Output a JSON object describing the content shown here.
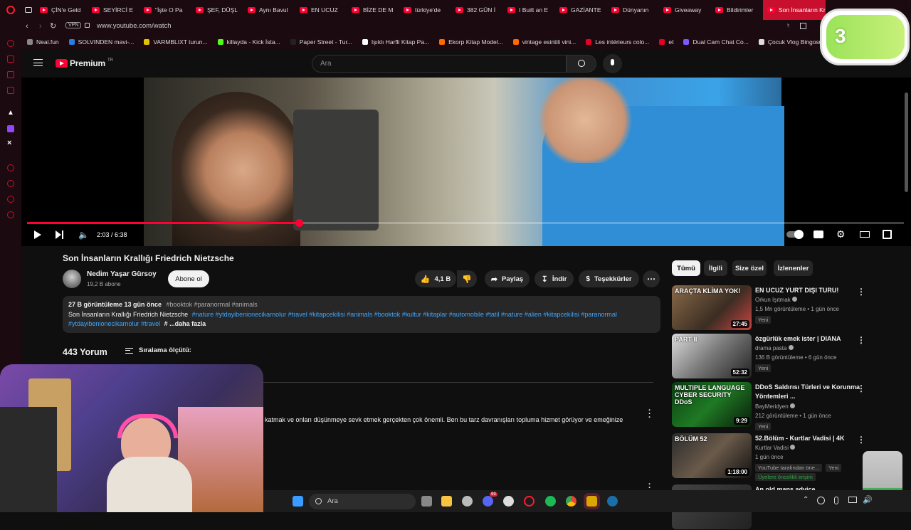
{
  "browser": {
    "tabs": [
      {
        "label": "ÇİN'e Geld",
        "active": false
      },
      {
        "label": "SEYİRCİ E",
        "active": false
      },
      {
        "label": "\"İşte O Pa",
        "active": false
      },
      {
        "label": "ŞEF, DÜŞL",
        "active": false
      },
      {
        "label": "Aynı Bavul",
        "active": false
      },
      {
        "label": "EN UCUZ",
        "active": false
      },
      {
        "label": "BİZE DE M",
        "active": false
      },
      {
        "label": "türkiye'de",
        "active": false
      },
      {
        "label": "382 GÜN İ",
        "active": false
      },
      {
        "label": "I Built an E",
        "active": false
      },
      {
        "label": "GAZİANTE",
        "active": false
      },
      {
        "label": "Dünyanın",
        "active": false
      },
      {
        "label": "Giveaway",
        "active": false
      },
      {
        "label": "Bildirimler",
        "active": false
      },
      {
        "label": "Son İnsanların Krallı",
        "active": true
      }
    ],
    "url": "www.youtube.com/watch",
    "vpn_label": "VPN",
    "bookmarks": [
      {
        "label": "Neal.fun",
        "color": "#888888"
      },
      {
        "label": "SOLVINDEN mavi-...",
        "color": "#2a7de1"
      },
      {
        "label": "VARMBLIXT turun...",
        "color": "#e5c100"
      },
      {
        "label": "killayda - Kick İsta...",
        "color": "#53fc18"
      },
      {
        "label": "Paper Street - Tur...",
        "color": "#222222"
      },
      {
        "label": "Işıklı Harfli Kitap Pa...",
        "color": "#ffffff"
      },
      {
        "label": "Ekorp Kitap Model...",
        "color": "#ff6a00"
      },
      {
        "label": "vintage esintili vini...",
        "color": "#ff6a00"
      },
      {
        "label": "Les intérieurs colo...",
        "color": "#e60023"
      },
      {
        "label": "et",
        "color": "#e60023"
      },
      {
        "label": "Dual Cam Chat Co...",
        "color": "#7a5af8"
      },
      {
        "label": "Çocuk Vlog Bingosu",
        "color": "#dddddd"
      }
    ]
  },
  "youtube": {
    "logo": "Premium",
    "logo_region": "TR",
    "search_placeholder": "Ara",
    "player": {
      "time": "2:03 / 6:38",
      "progress_fraction": 0.31
    },
    "video": {
      "title": "Son İnsanların Krallığı Friedrich Nietzsche",
      "channel": "Nedim Yaşar Gürsoy",
      "subscribers": "19,2 B abone",
      "subscribe_label": "Abone ol",
      "likes": "4,1 B",
      "share_label": "Paylaş",
      "download_label": "İndir",
      "thanks_label": "Teşekkürler",
      "views_line": "27 B görüntüleme  13 gün önce",
      "views_tags": "#booktok #paranormal #animals",
      "desc_title": "Son İnsanların Krallığı Friedrich Nietzsche",
      "desc_tags": "#nature #ytdayibenionecikarnolur #travel #kitapcekilisi #animals #booktok #kultur #kitaplar #automobile #tatil #nature #alien #kitapcekilisi #paranormal",
      "desc_tags2": "#ytdayibenionecikarnolur #travel",
      "desc_more": "# ...daha fazla"
    },
    "comments": {
      "count": "443 Yorum",
      "sort_label": "Sıralama ölçütü:",
      "visible_text": "katmak ve onları düşünmeye sevk etmek gerçekten çok önemli. Ben bu tarz davranışları topluma hizmet görüyor ve emeğinize"
    },
    "filter_chips": [
      {
        "label": "Tümü",
        "active": true
      },
      {
        "label": "İlgili",
        "active": false
      },
      {
        "label": "Size özel",
        "active": false
      },
      {
        "label": "İzlenenler",
        "active": false
      }
    ],
    "recommendations": [
      {
        "title": "EN UCUZ YURT DIŞI TURU!",
        "channel": "Orkun Işıtmak",
        "stats": "1,5 Mn görüntüleme • 1 gün önce",
        "badge": "Yeni",
        "duration": "27:45",
        "thumb_text": "ARAÇTA KLİMA YOK!"
      },
      {
        "title": "özgürlük emek ister | DIANA",
        "channel": "drama pasta",
        "stats": "136 B görüntüleme • 6 gün önce",
        "badge": "Yeni",
        "duration": "52:32",
        "thumb_text": "PART II"
      },
      {
        "title": "DDoS Saldırısı Türleri ve Korunma Yöntemleri ...",
        "channel": "BayMeridyen",
        "stats": "212 görüntüleme • 1 gün önce",
        "badge": "Yeni",
        "duration": "9:29",
        "thumb_text": "MULTIPLE LANGUAGE CYBER SECURITY DDoS"
      },
      {
        "title": "52.Bölüm - Kurtlar Vadisi | 4K",
        "channel": "Kurtlar Vadisi",
        "stats": "1 gün önce",
        "badge": "YouTube tarafından öne...",
        "badge2": "Yeni",
        "extra": "Üyelere öncelikli erişim",
        "duration": "1:18:00",
        "thumb_text": "BÖLÜM 52"
      },
      {
        "title": "An old mans advice",
        "channel": "",
        "stats": "",
        "badge": "",
        "duration": "",
        "thumb_text": ""
      }
    ]
  },
  "overlay": {
    "counter": "3"
  },
  "taskbar": {
    "search_label": "Ara",
    "notif_count": "99"
  },
  "colors": {
    "brand_red": "#ff0033",
    "opera_red": "#c8102e",
    "link_blue": "#3ea6ff",
    "bg": "#0f0f0f"
  }
}
